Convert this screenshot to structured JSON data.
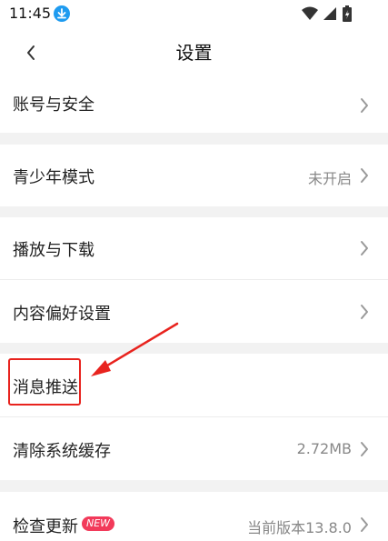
{
  "status_bar": {
    "time": "11:45"
  },
  "header": {
    "title": "设置"
  },
  "settings": {
    "account": {
      "label": "账号与安全"
    },
    "teen_mode": {
      "label": "青少年模式",
      "value": "未开启"
    },
    "playback": {
      "label": "播放与下载"
    },
    "content_pref": {
      "label": "内容偏好设置"
    },
    "push": {
      "label": "消息推送"
    },
    "cache": {
      "label": "清除系统缓存",
      "value": "2.72MB"
    },
    "update": {
      "label": "检查更新",
      "badge": "NEW",
      "value": "当前版本13.8.0"
    }
  },
  "colors": {
    "highlight": "#e8231e",
    "badge": "#f23a5a",
    "download": "#1e9bf0"
  },
  "icons": [
    "back-icon",
    "chevron-right-icon",
    "download-icon",
    "wifi-icon",
    "signal-icon",
    "battery-icon"
  ]
}
